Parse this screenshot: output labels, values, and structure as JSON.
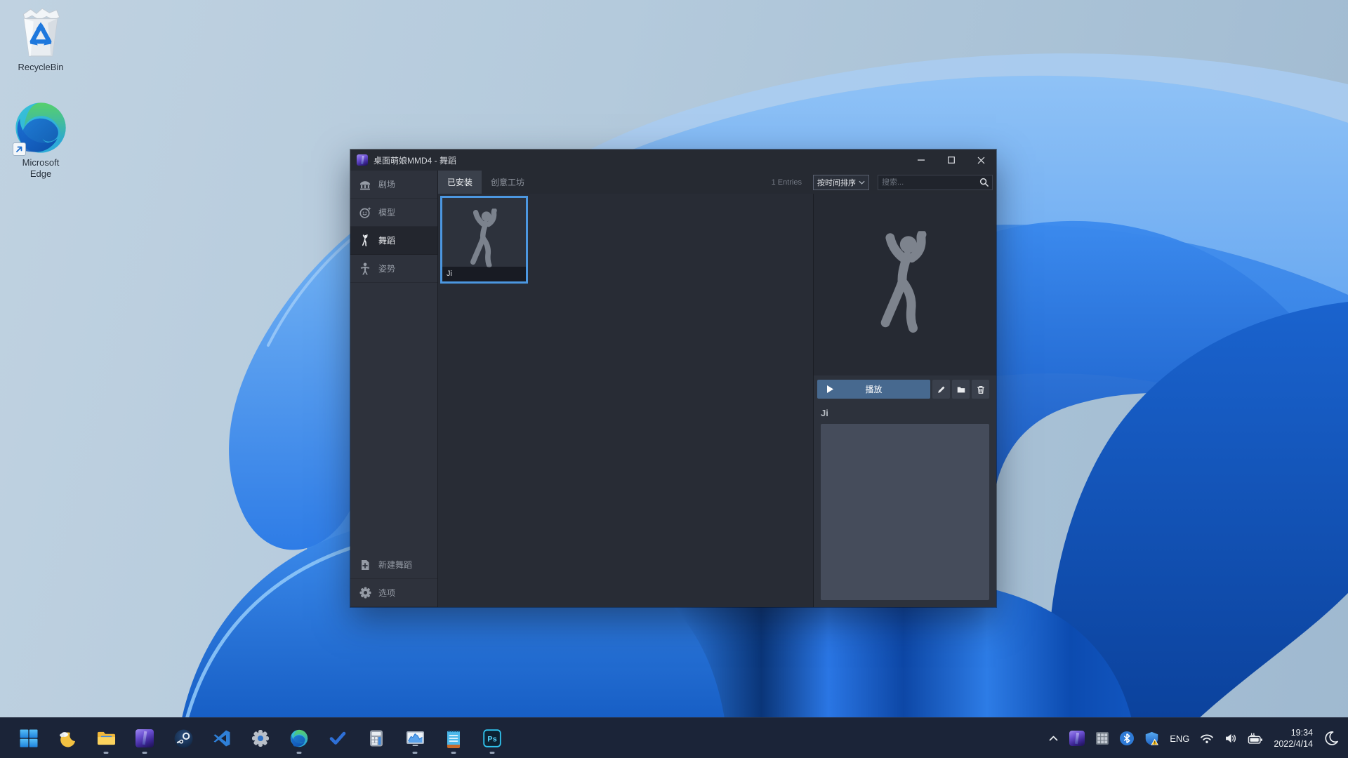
{
  "desktop": {
    "icons": [
      {
        "label": "RecycleBin"
      },
      {
        "label": "Microsoft Edge"
      }
    ]
  },
  "window": {
    "title": "桌面萌娘MMD4 - 舞蹈",
    "sidebar": {
      "items": [
        {
          "label": "剧场"
        },
        {
          "label": "模型"
        },
        {
          "label": "舞蹈",
          "selected": true
        },
        {
          "label": "姿势"
        }
      ],
      "footer": [
        {
          "label": "新建舞蹈"
        },
        {
          "label": "选项"
        }
      ]
    },
    "toolbar": {
      "tabs": [
        {
          "label": "已安装",
          "selected": true
        },
        {
          "label": "创意工坊"
        }
      ],
      "entries": "1 Entries",
      "sort": "按时间排序",
      "search_placeholder": "搜索..."
    },
    "content": {
      "cards": [
        {
          "label": "Ji",
          "selected": true
        }
      ]
    },
    "detail": {
      "play": "播放",
      "name": "Ji"
    }
  },
  "taskbar": {
    "app_icons": [
      "start",
      "weather-moon",
      "file-explorer",
      "mmd-app",
      "steam",
      "vscode",
      "settings",
      "edge",
      "todo-check",
      "calculator",
      "task-manager",
      "notepad",
      "photoshop"
    ],
    "tray_icons": [
      "chevron-up",
      "mmd-app",
      "grid-app",
      "bluetooth",
      "security-shield-warning",
      "language",
      "wifi",
      "volume",
      "battery-charging",
      "clock",
      "night-moon"
    ],
    "tray": {
      "language": "ENG",
      "time": "19:34",
      "date": "2022/4/14"
    }
  },
  "colors": {
    "selection_accent": "#4c97e0",
    "play_button": "#47698f",
    "window_chrome": "#262a32",
    "sidebar_bg": "#2e323c",
    "taskbar_bg": "#1b2438"
  }
}
